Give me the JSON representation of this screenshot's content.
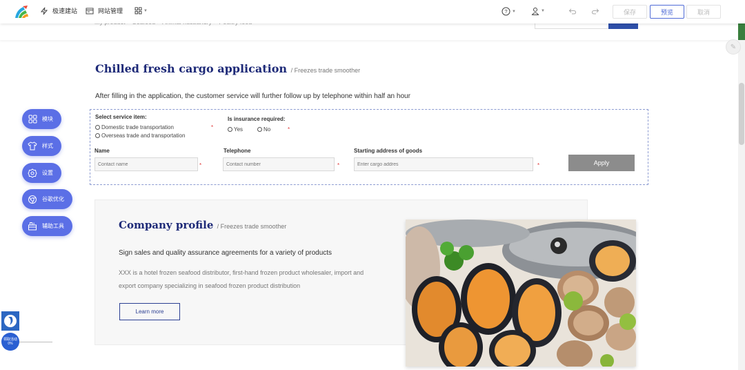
{
  "toolbar": {
    "quick_build": "极速建站",
    "site_manage": "网站管理",
    "save": "保存",
    "preview": "预览",
    "cancel": "取消",
    "accent": "#4f6bd6"
  },
  "under_header": {
    "breadcrumb": "My product > Seafood > Animal husbandry > Poultry food"
  },
  "application": {
    "title": "Chilled fresh cargo application",
    "subtitle": "/ Freezes trade smoother",
    "intro": "After filling in the application, the customer service will further follow up by telephone within half an hour",
    "service_label": "Select service item:",
    "service_options": [
      "Domestic trade transportation",
      "Overseas trade and transportation"
    ],
    "insurance_label": "Is insurance required:",
    "insurance_options": [
      "Yes",
      "No"
    ],
    "name_label": "Name",
    "name_placeholder": "Contact name",
    "phone_label": "Telephone",
    "phone_placeholder": "Contact number",
    "address_label": "Starting address of goods",
    "address_placeholder": "Enter cargo addres",
    "required_mark": "*",
    "apply": "Apply"
  },
  "profile": {
    "title": "Company profile",
    "subtitle": "/ Freezes trade smoother",
    "headline": "Sign sales and quality assurance agreements for a variety of products",
    "description": "XXX is a hotel frozen seafood distributor, first-hand frozen product wholesaler, import and export company specializing in seafood frozen product distribution",
    "learn_more": "Learn more"
  },
  "float_menu": [
    {
      "label": "模块",
      "icon": "grid-icon"
    },
    {
      "label": "样式",
      "icon": "shirt-icon"
    },
    {
      "label": "设置",
      "icon": "gear-icon"
    },
    {
      "label": "谷歌优化",
      "icon": "chrome-icon"
    },
    {
      "label": "辅助工具",
      "icon": "toolbox-icon"
    }
  ],
  "side_badge": {
    "line1": "领取活动",
    "line2": "0%"
  }
}
